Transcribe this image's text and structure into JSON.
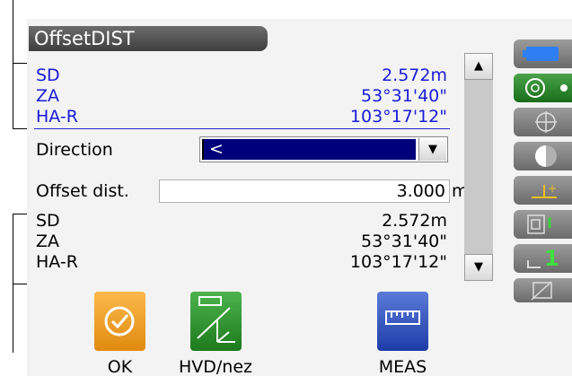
{
  "window": {
    "title": "OffsetDIST"
  },
  "top_block": [
    {
      "label": "SD",
      "value": "2.572m"
    },
    {
      "label": "ZA",
      "value": "53°31'40\""
    },
    {
      "label": "HA-R",
      "value": "103°17'12\""
    }
  ],
  "direction": {
    "label": "Direction",
    "value": "<"
  },
  "offset": {
    "label": "Offset dist.",
    "value": "3.000",
    "unit": "m"
  },
  "bottom_block": [
    {
      "label": "SD",
      "value": "2.572m"
    },
    {
      "label": "ZA",
      "value": "53°31'40\""
    },
    {
      "label": "HA-R",
      "value": "103°17'12\""
    }
  ],
  "softkeys": {
    "ok": "OK",
    "hvd": "HVD/nez",
    "meas": "MEAS"
  },
  "side_icons": [
    "battery-icon",
    "target-icon",
    "crosshair-icon",
    "half-circle-icon",
    "level-icon",
    "prism-icon",
    "channel-icon",
    "edit-icon"
  ],
  "side_channel": "1",
  "colors": {
    "accent_blue": "#1a1ad8",
    "select_bg": "#00007a",
    "ok_orange": "#f29f1e",
    "hvd_green": "#2e8f2e",
    "meas_blue": "#2d4fc2"
  }
}
